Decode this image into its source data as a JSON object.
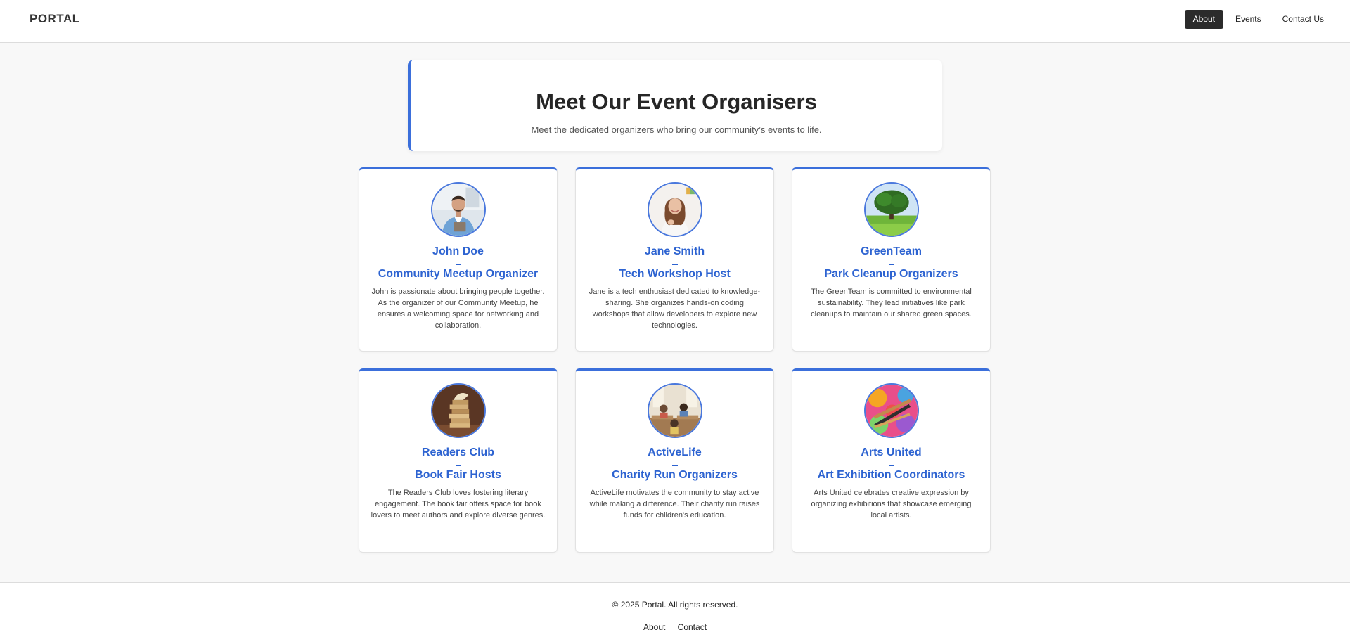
{
  "header": {
    "logo": "PORTAL",
    "nav": [
      "About",
      "Events",
      "Contact Us"
    ]
  },
  "hero": {
    "title": "Meet Our Event Organisers",
    "subtitle": "Meet the dedicated organizers who bring our community’s events to life."
  },
  "organizers": [
    {
      "name": "John Doe",
      "role": "Community Meetup Organizer",
      "description": "John is passionate about bringing people together. As the organizer of our Community Meetup, he ensures a welcoming space for networking and collaboration.",
      "image": "man-with-tablet-photo"
    },
    {
      "name": "Jane Smith",
      "role": "Tech Workshop Host",
      "description": "Jane is a tech enthusiast dedicated to knowledge-sharing. She organizes hands-on coding workshops that allow developers to explore new technologies.",
      "image": "smiling-woman-photo"
    },
    {
      "name": "GreenTeam",
      "role": "Park Cleanup Organizers",
      "description": "The GreenTeam is committed to environmental sustainability. They lead initiatives like park cleanups to maintain our shared green spaces.",
      "image": "tree-in-field-photo"
    },
    {
      "name": "Readers Club",
      "role": "Book Fair Hosts",
      "description": "The Readers Club loves fostering literary engagement. The book fair offers space for book lovers to meet authors and explore diverse genres.",
      "image": "stack-of-books-photo"
    },
    {
      "name": "ActiveLife",
      "role": "Charity Run Organizers",
      "description": "ActiveLife motivates the community to stay active while making a difference. Their charity run raises funds for children's education.",
      "image": "classroom-children-photo"
    },
    {
      "name": "Arts United",
      "role": "Art Exhibition Coordinators",
      "description": "Arts United celebrates creative expression by organizing exhibitions that showcase emerging local artists.",
      "image": "paint-brushes-photo"
    }
  ],
  "footer": {
    "copyright": "© 2025 Portal. All rights reserved.",
    "links": [
      "About",
      "Contact"
    ]
  },
  "colors": {
    "accent": "#3b6fdb",
    "title_blue": "#2d63d1",
    "nav_active_bg": "#2b2b2b",
    "page_bg": "#f8f8f8"
  }
}
